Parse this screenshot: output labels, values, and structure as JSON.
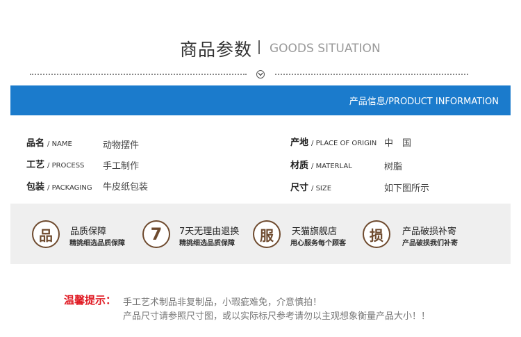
{
  "header": {
    "title_cn": "商品参数",
    "title_en": "GOODS SITUATION"
  },
  "banner": {
    "label": "产品信息/PRODUCT INFORMATION",
    "color": "#1b7bcc"
  },
  "params": {
    "name": {
      "label": "品名",
      "label_en": "/ NAME",
      "value": "动物摆件"
    },
    "process": {
      "label": "工艺",
      "label_en": "/ PROCESS",
      "value": "手工制作"
    },
    "packaging": {
      "label": "包装",
      "label_en": "/ PACKAGING",
      "value": "牛皮纸包装"
    },
    "origin": {
      "label": "产地",
      "label_en": "/ PLACE OF ORIGIN",
      "value": "中　国"
    },
    "material": {
      "label": "材质",
      "label_en": "/ MATERLAL",
      "value": "树脂"
    },
    "size": {
      "label": "尺寸",
      "label_en": "/ SIZE",
      "value": "如下图所示"
    }
  },
  "services": [
    {
      "icon": "品",
      "title": "品质保障",
      "subtitle": "精挑细选品质保障"
    },
    {
      "icon": "7",
      "title": "7天无理由退换",
      "subtitle": "精挑细选品质保障"
    },
    {
      "icon": "服",
      "title": "天猫旗舰店",
      "subtitle": "用心服务每个顾客"
    },
    {
      "icon": "损",
      "title": "产品破损补寄",
      "subtitle": "产品破损我们补寄"
    }
  ],
  "notice": {
    "label": "温馨提示：",
    "line1": "手工艺术制品非复制品，小瑕疵难免，介意慎拍！",
    "line2": "产品尺寸请参照尺寸图，或以实际标尺参考请勿以主观想象衡量产品大小！！",
    "color": "#e01b24"
  }
}
